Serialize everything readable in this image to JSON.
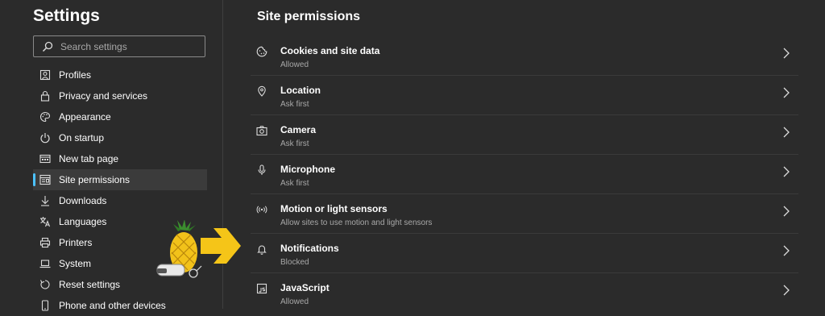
{
  "sidebar": {
    "title": "Settings",
    "search": {
      "placeholder": "Search settings",
      "icon": "search-icon"
    },
    "items": [
      {
        "label": "Profiles",
        "icon": "profile-icon"
      },
      {
        "label": "Privacy and services",
        "icon": "lock-icon"
      },
      {
        "label": "Appearance",
        "icon": "palette-icon"
      },
      {
        "label": "On startup",
        "icon": "power-icon"
      },
      {
        "label": "New tab page",
        "icon": "new-tab-icon"
      },
      {
        "label": "Site permissions",
        "icon": "site-permissions-icon",
        "active": true
      },
      {
        "label": "Downloads",
        "icon": "download-icon"
      },
      {
        "label": "Languages",
        "icon": "languages-icon"
      },
      {
        "label": "Printers",
        "icon": "printer-icon"
      },
      {
        "label": "System",
        "icon": "laptop-icon"
      },
      {
        "label": "Reset settings",
        "icon": "reset-icon"
      },
      {
        "label": "Phone and other devices",
        "icon": "phone-icon"
      }
    ]
  },
  "main": {
    "title": "Site permissions",
    "permissions": [
      {
        "name": "Cookies and site data",
        "status": "Allowed",
        "icon": "cookie-icon"
      },
      {
        "name": "Location",
        "status": "Ask first",
        "icon": "location-pin-icon"
      },
      {
        "name": "Camera",
        "status": "Ask first",
        "icon": "camera-icon"
      },
      {
        "name": "Microphone",
        "status": "Ask first",
        "icon": "microphone-icon"
      },
      {
        "name": "Motion or light sensors",
        "status": "Allow sites to use motion and light sensors",
        "icon": "sensor-icon"
      },
      {
        "name": "Notifications",
        "status": "Blocked",
        "icon": "bell-icon"
      },
      {
        "name": "JavaScript",
        "status": "Allowed",
        "icon": "javascript-icon"
      }
    ]
  },
  "colors": {
    "background": "#2b2b2b",
    "accent": "#4cc2ff",
    "active_item_bg": "#3b3b3b",
    "secondary_text": "#a8a8a8",
    "arrow": "#f5c518"
  }
}
